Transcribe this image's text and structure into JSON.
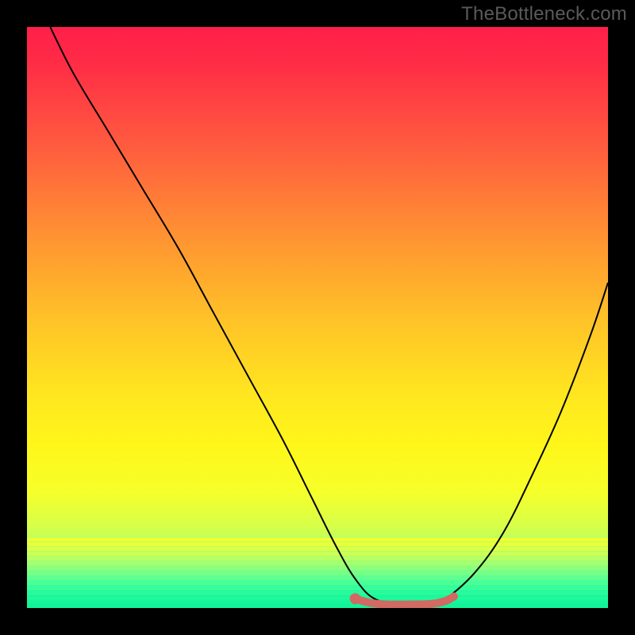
{
  "watermark": "TheBottleneck.com",
  "chart_data": {
    "type": "line",
    "title": "",
    "xlabel": "",
    "ylabel": "",
    "xlim": [
      0,
      100
    ],
    "ylim": [
      0,
      100
    ],
    "series": [
      {
        "name": "curve",
        "color": "#000000",
        "x": [
          4,
          8,
          14,
          20,
          26,
          32,
          38,
          44,
          49,
          53,
          56.5,
          60,
          65,
          70,
          72,
          77,
          82,
          87,
          92,
          97,
          100
        ],
        "values": [
          100,
          92,
          82,
          72,
          62,
          51,
          40,
          29,
          19,
          11,
          5,
          1.5,
          0.8,
          0.8,
          1.5,
          6,
          13,
          23,
          34,
          47,
          56
        ]
      },
      {
        "name": "bottom-highlight",
        "color": "#d16a62",
        "x": [
          56.5,
          59,
          62,
          66,
          69.5,
          72,
          73.5
        ],
        "values": [
          1.6,
          0.9,
          0.6,
          0.6,
          0.7,
          1.2,
          2.0
        ]
      }
    ],
    "marker": {
      "x": 56.5,
      "y": 1.6,
      "color": "#d16a62"
    },
    "background_gradient": {
      "top": "#ff1f4a",
      "mid": "#ffe81f",
      "bottom": "#16f79a"
    }
  }
}
